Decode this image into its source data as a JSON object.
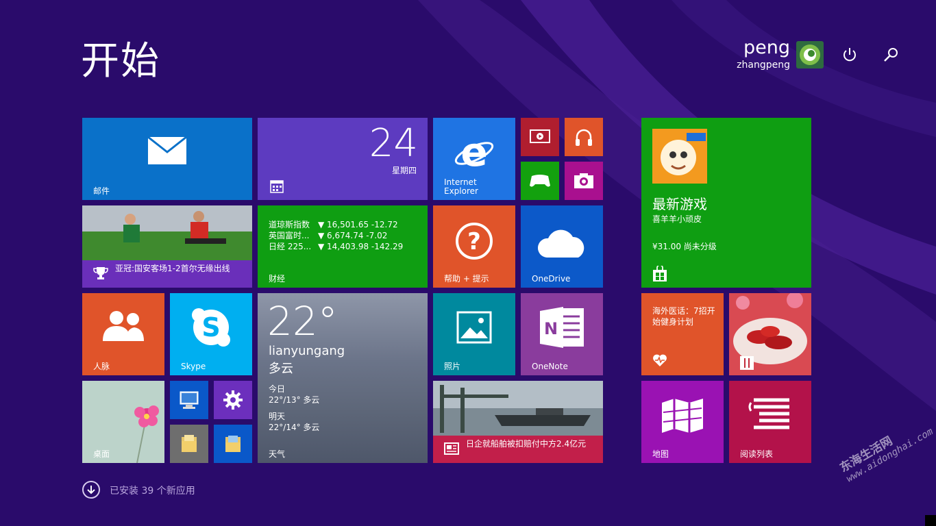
{
  "header": {
    "title": "开始",
    "user_first": "peng",
    "user_last": "zhangpeng"
  },
  "tiles": {
    "mail": {
      "label": "邮件"
    },
    "calendar": {
      "day": "24",
      "weekday": "星期四"
    },
    "ie": {
      "label_line1": "Internet",
      "label_line2": "Explorer"
    },
    "sports": {
      "caption": "亚冠:国安客场1-2首尔无缘出线"
    },
    "finance": {
      "label": "财经",
      "rows": [
        {
          "name": "道琼斯指数",
          "value": "▼ 16,501.65 -12.72"
        },
        {
          "name": "英国富时...",
          "value": "▼ 6,674.74 -7.02"
        },
        {
          "name": "日经 225...",
          "value": "▼ 14,403.98 -142.29"
        }
      ]
    },
    "help": {
      "label": "帮助 + 提示"
    },
    "onedrive": {
      "label": "OneDrive"
    },
    "store": {
      "title": "最新游戏",
      "game": "喜羊羊小顽皮",
      "price": "¥31.00 尚未分级"
    },
    "people": {
      "label": "人脉"
    },
    "skype": {
      "label": "Skype"
    },
    "weather": {
      "temp": "22°",
      "city": "lianyungang",
      "condition": "多云",
      "today_label": "今日",
      "today_value": "22°/13° 多云",
      "tomorrow_label": "明天",
      "tomorrow_value": "22°/14° 多云",
      "label": "天气"
    },
    "photos": {
      "label": "照片"
    },
    "onenote": {
      "label": "OneNote"
    },
    "health": {
      "caption": "海外医话：7招开始健身计划"
    },
    "desktop": {
      "label": "桌面"
    },
    "news": {
      "caption": "日企就船舶被扣赔付中方2.4亿元"
    },
    "maps": {
      "label": "地图"
    },
    "reading": {
      "label": "阅读列表"
    }
  },
  "footer": {
    "apps_text": "已安装 39 个新应用"
  },
  "watermark": {
    "line1": "东海生活网",
    "line2": "www.aidonghai.com"
  }
}
